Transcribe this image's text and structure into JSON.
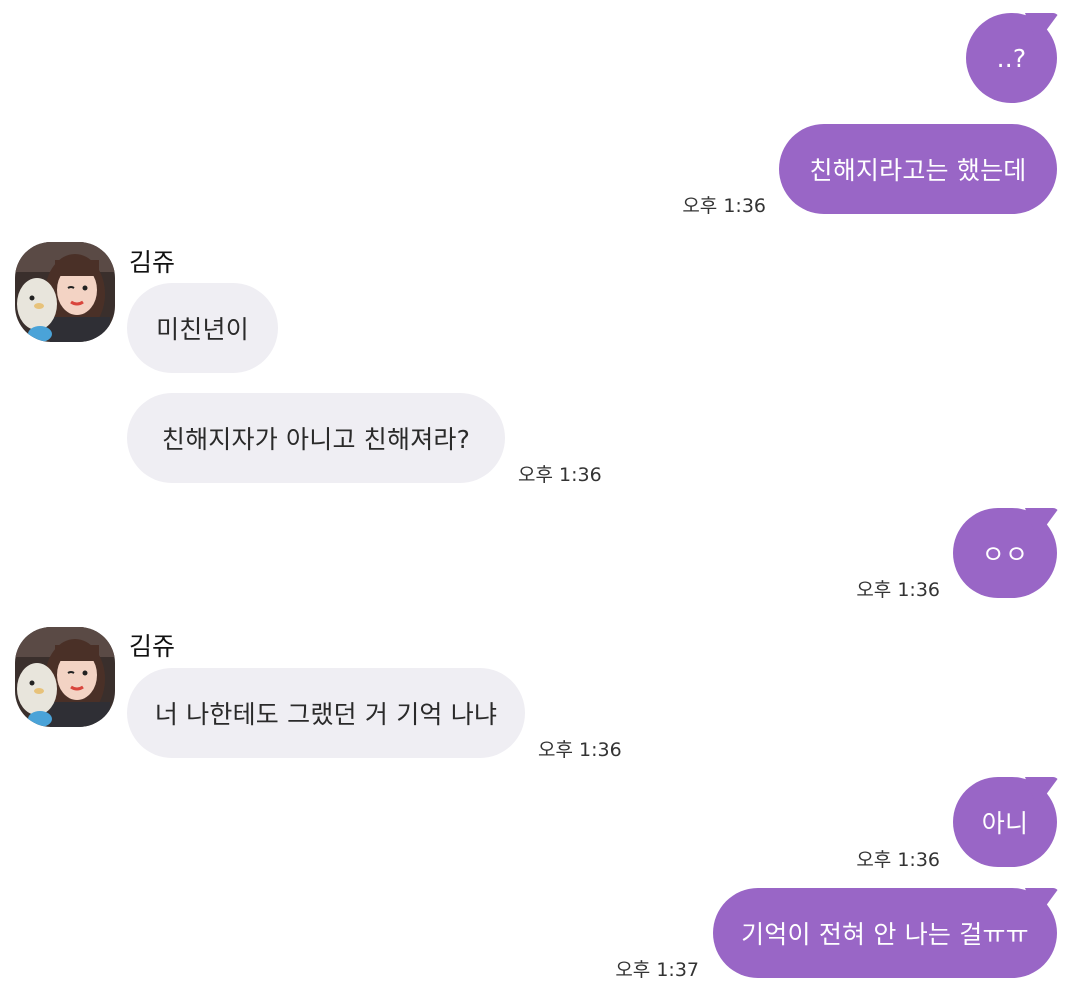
{
  "conversation": {
    "messages": [
      {
        "id": "m1",
        "side": "me",
        "text": "..?",
        "time": ""
      },
      {
        "id": "m2",
        "side": "me",
        "text": "친해지라고는 했는데",
        "time": "오후 1:36"
      },
      {
        "id": "m3",
        "side": "them",
        "sender": "김쥬",
        "text": "미친년이",
        "time": ""
      },
      {
        "id": "m4",
        "side": "them",
        "text": "친해지자가 아니고 친해져라?",
        "time": "오후 1:36"
      },
      {
        "id": "m5",
        "side": "me",
        "text": "ㅇㅇ",
        "time": "오후 1:36"
      },
      {
        "id": "m6",
        "side": "them",
        "sender": "김쥬",
        "text": "너 나한테도 그랬던 거 기억 나냐",
        "time": "오후 1:36"
      },
      {
        "id": "m7",
        "side": "me",
        "text": "아니",
        "time": "오후 1:36"
      },
      {
        "id": "m8",
        "side": "me",
        "text": "기억이 전혀 안 나는 걸ㅠㅠ",
        "time": "오후 1:37"
      }
    ]
  },
  "contact": {
    "avatar_icon": "profile-photo"
  },
  "colors": {
    "my_bubble": "#9966c6",
    "their_bubble": "#efeef3",
    "background": "#ffffff"
  }
}
